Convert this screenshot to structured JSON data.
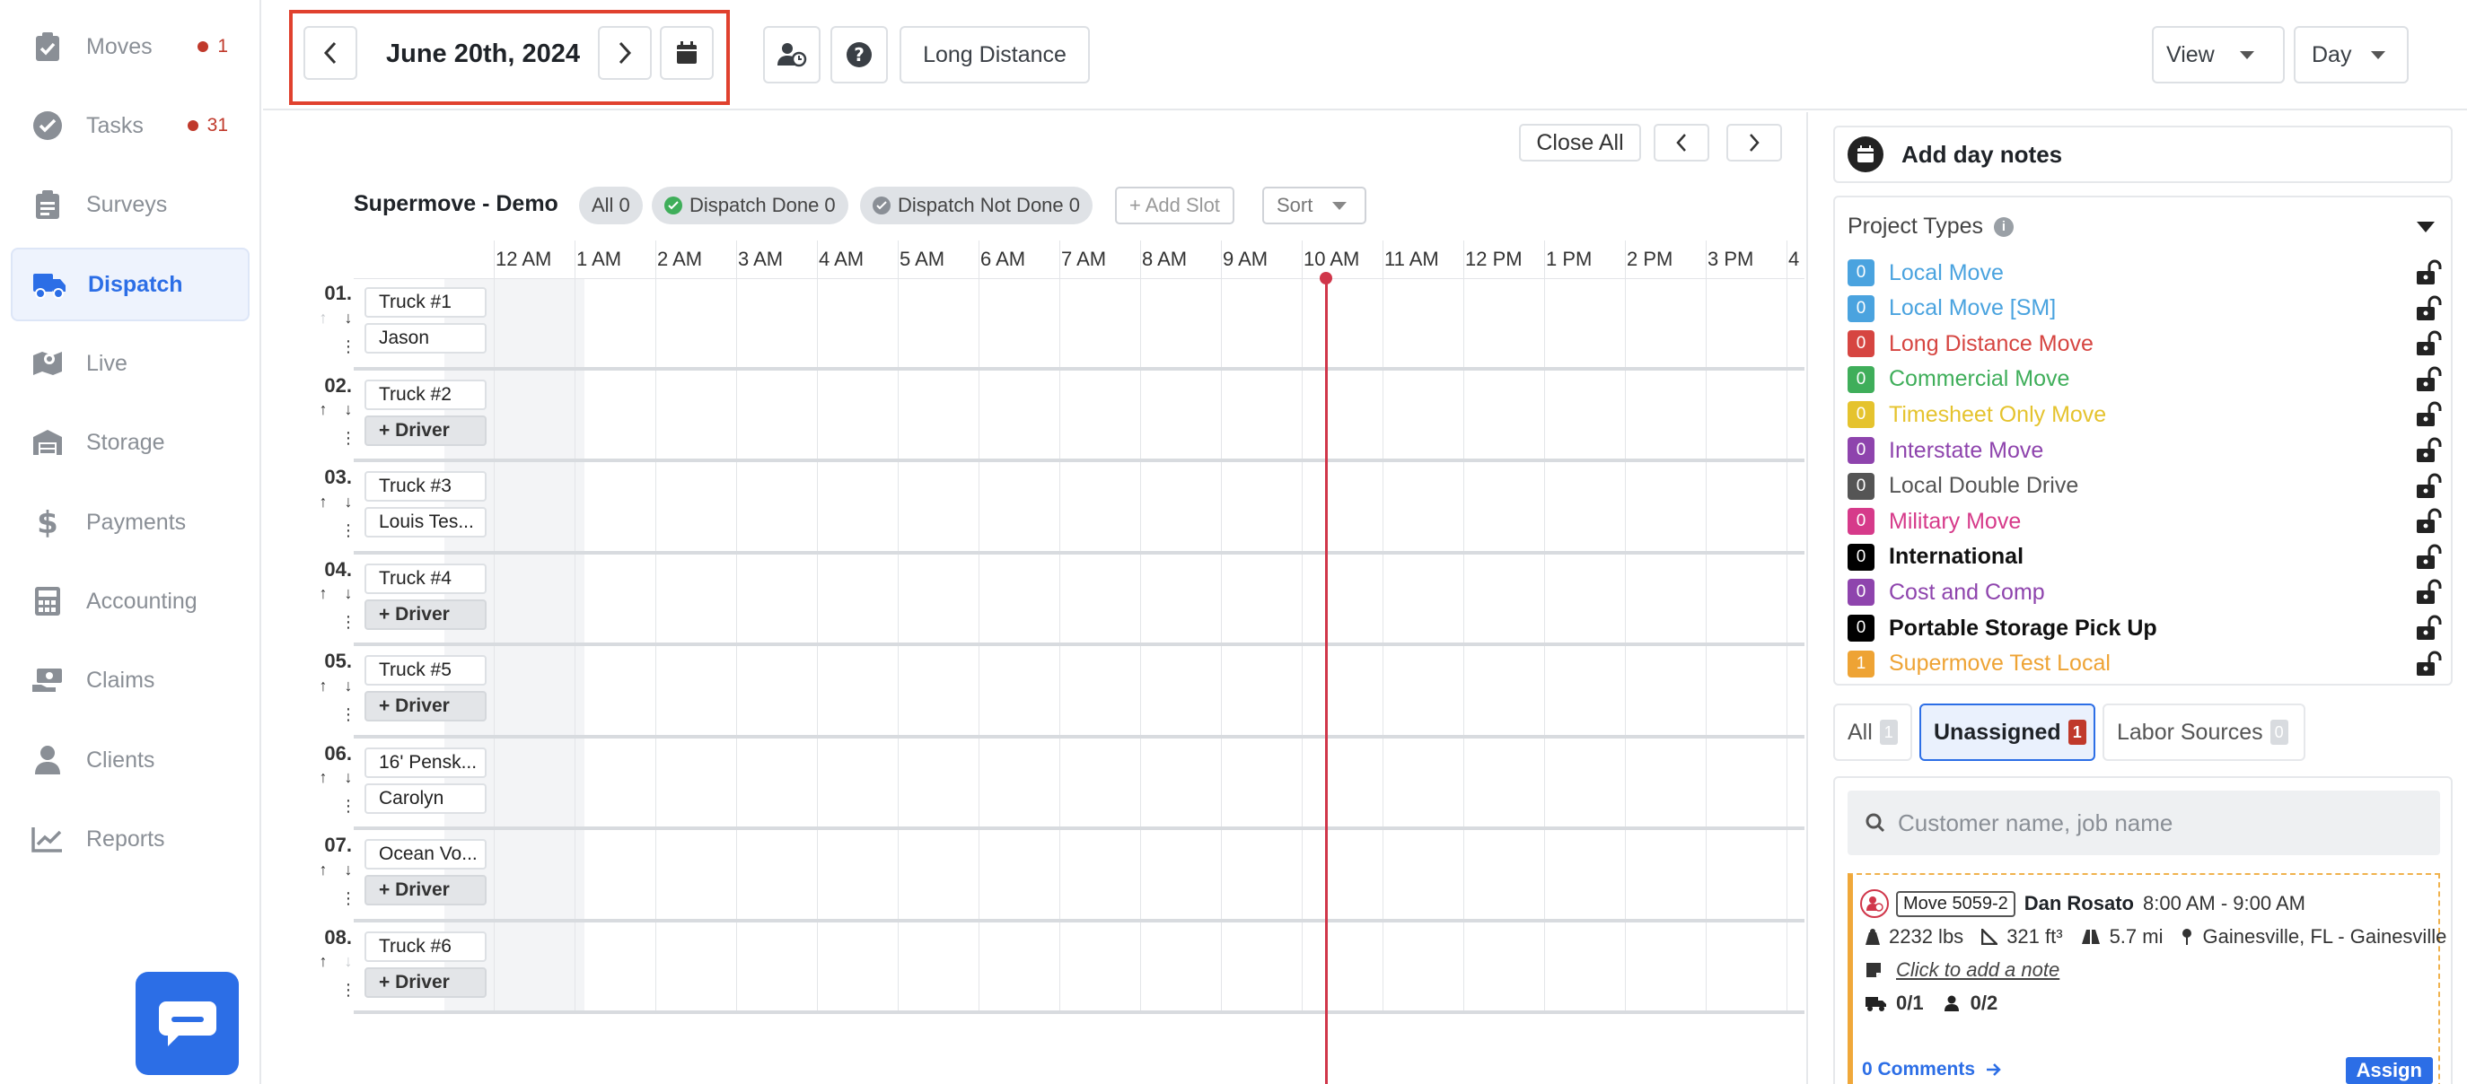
{
  "sidebar": {
    "items": [
      {
        "label": "Moves",
        "badge": "1"
      },
      {
        "label": "Tasks",
        "badge": "31"
      },
      {
        "label": "Surveys",
        "badge": ""
      },
      {
        "label": "Dispatch",
        "badge": ""
      },
      {
        "label": "Live",
        "badge": ""
      },
      {
        "label": "Storage",
        "badge": ""
      },
      {
        "label": "Payments",
        "badge": ""
      },
      {
        "label": "Accounting",
        "badge": ""
      },
      {
        "label": "Claims",
        "badge": ""
      },
      {
        "label": "Clients",
        "badge": ""
      },
      {
        "label": "Reports",
        "badge": ""
      }
    ],
    "active": "Dispatch"
  },
  "topbar": {
    "date": "June 20th, 2024",
    "long_distance_label": "Long Distance",
    "view_label": "View",
    "day_label": "Day"
  },
  "timeline": {
    "close_all_label": "Close All",
    "org_name": "Supermove - Demo",
    "filters": {
      "all": "All 0",
      "done": "Dispatch Done 0",
      "not_done": "Dispatch Not Done 0"
    },
    "add_slot_label": "+ Add Slot",
    "sort_label": "Sort",
    "hours": [
      "12 AM",
      "1 AM",
      "2 AM",
      "3 AM",
      "4 AM",
      "5 AM",
      "6 AM",
      "7 AM",
      "8 AM",
      "9 AM",
      "10 AM",
      "11 AM",
      "12 PM",
      "1 PM",
      "2 PM",
      "3 PM",
      "4"
    ],
    "rows": [
      {
        "num": "01.",
        "truck": "Truck #1",
        "driver": "Jason",
        "driver_assigned": true,
        "up_disabled": true,
        "down_disabled": false
      },
      {
        "num": "02.",
        "truck": "Truck #2",
        "driver": "+ Driver",
        "driver_assigned": false,
        "up_disabled": false,
        "down_disabled": false
      },
      {
        "num": "03.",
        "truck": "Truck #3",
        "driver": "Louis Tes...",
        "driver_assigned": true,
        "up_disabled": false,
        "down_disabled": false
      },
      {
        "num": "04.",
        "truck": "Truck #4",
        "driver": "+ Driver",
        "driver_assigned": false,
        "up_disabled": false,
        "down_disabled": false
      },
      {
        "num": "05.",
        "truck": "Truck #5",
        "driver": "+ Driver",
        "driver_assigned": false,
        "up_disabled": false,
        "down_disabled": false
      },
      {
        "num": "06.",
        "truck": "16' Pensk...",
        "driver": "Carolyn",
        "driver_assigned": true,
        "up_disabled": false,
        "down_disabled": false
      },
      {
        "num": "07.",
        "truck": "Ocean Vo...",
        "driver": "+ Driver",
        "driver_assigned": false,
        "up_disabled": false,
        "down_disabled": false
      },
      {
        "num": "08.",
        "truck": "Truck #6",
        "driver": "+ Driver",
        "driver_assigned": false,
        "up_disabled": false,
        "down_disabled": true
      }
    ]
  },
  "right_panel": {
    "day_notes_label": "Add day notes",
    "project_types_title": "Project Types",
    "project_types": [
      {
        "count": "0",
        "name": "Local Move",
        "color": "#4aa3df"
      },
      {
        "count": "0",
        "name": "Local Move [SM]",
        "color": "#4aa3df"
      },
      {
        "count": "0",
        "name": "Long Distance Move",
        "color": "#d64541"
      },
      {
        "count": "0",
        "name": "Commercial Move",
        "color": "#3fae5a"
      },
      {
        "count": "0",
        "name": "Timesheet Only Move",
        "color": "#e5c32e"
      },
      {
        "count": "0",
        "name": "Interstate Move",
        "color": "#8e44ad"
      },
      {
        "count": "0",
        "name": "Local Double Drive",
        "color": "#555555"
      },
      {
        "count": "0",
        "name": "Military Move",
        "color": "#d63a8a"
      },
      {
        "count": "0",
        "name": "International",
        "color": "#000000"
      },
      {
        "count": "0",
        "name": "Cost and Comp",
        "color": "#8e44ad"
      },
      {
        "count": "0",
        "name": "Portable Storage Pick Up",
        "color": "#000000"
      },
      {
        "count": "1",
        "name": "Supermove Test Local",
        "color": "#eea334"
      }
    ],
    "tabs": [
      {
        "label": "All",
        "count": "1"
      },
      {
        "label": "Unassigned",
        "count": "1"
      },
      {
        "label": "Labor Sources",
        "count": "0"
      }
    ],
    "search_placeholder": "Customer name, job name",
    "move_card": {
      "tag": "Move 5059-2",
      "customer": "Dan Rosato",
      "time": "8:00 AM - 9:00 AM",
      "weight": "2232 lbs",
      "volume": "321 ft³",
      "distance": "5.7 mi",
      "location": "Gainesville, FL - Gainesville",
      "note_prompt": "Click to add a note",
      "trucks": "0/1",
      "crew": "0/2",
      "comments": "0 Comments",
      "assign_label": "Assign"
    }
  }
}
